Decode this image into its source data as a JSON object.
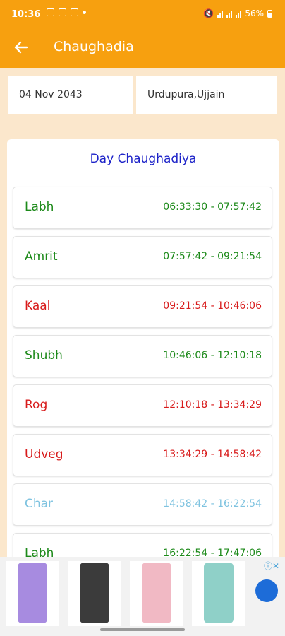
{
  "status": {
    "time": "10:36",
    "battery": "56%"
  },
  "appbar": {
    "title": "Chaughadia",
    "back_icon": "arrow-left-icon"
  },
  "info": {
    "date": "04 Nov 2043",
    "location": "Urdupura,Ujjain"
  },
  "section": {
    "title": "Day Chaughadiya"
  },
  "rows": [
    {
      "name": "Labh",
      "time": "06:33:30 - 07:57:42",
      "kind": "good"
    },
    {
      "name": "Amrit",
      "time": "07:57:42 - 09:21:54",
      "kind": "good"
    },
    {
      "name": "Kaal",
      "time": "09:21:54 - 10:46:06",
      "kind": "bad"
    },
    {
      "name": "Shubh",
      "time": "10:46:06 - 12:10:18",
      "kind": "good"
    },
    {
      "name": "Rog",
      "time": "12:10:18 - 13:34:29",
      "kind": "bad"
    },
    {
      "name": "Udveg",
      "time": "13:34:29 - 14:58:42",
      "kind": "bad"
    },
    {
      "name": "Char",
      "time": "14:58:42 - 16:22:54",
      "kind": "neutral"
    },
    {
      "name": "Labh",
      "time": "16:22:54 - 17:47:06",
      "kind": "good"
    }
  ],
  "colors": {
    "accent": "#f7a00f",
    "good": "#1d8a1a",
    "bad": "#d81b1b",
    "neutral": "#7fc3e0",
    "heading": "#1c22c8"
  },
  "ad": {
    "close_icon": "ad-choices-icon"
  }
}
